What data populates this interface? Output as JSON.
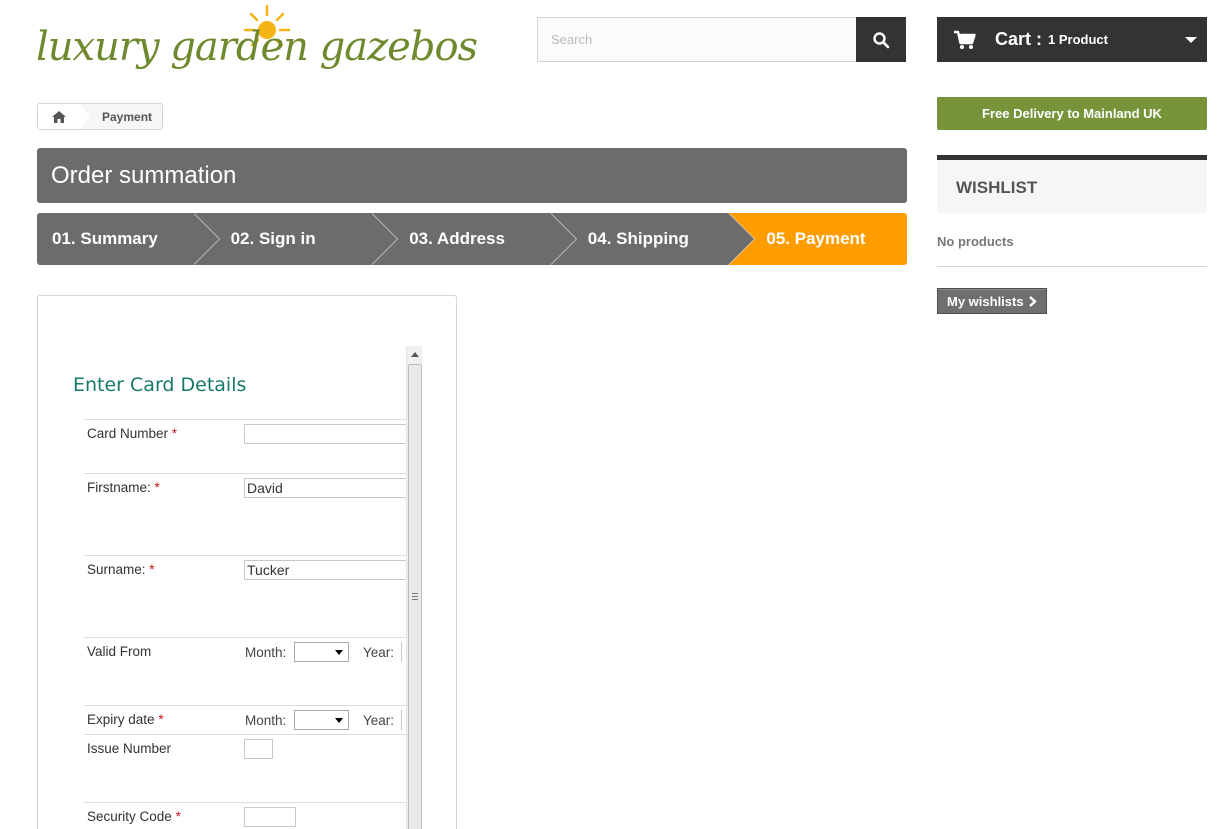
{
  "logo": {
    "text": "luxury garden gazebos"
  },
  "search": {
    "placeholder": "Search"
  },
  "cart": {
    "label": "Cart :",
    "quantity": "1 Product"
  },
  "delivery": {
    "text": "Free Delivery to Mainland UK"
  },
  "breadcrumb": {
    "current": "Payment"
  },
  "page": {
    "title": "Order summation"
  },
  "steps": [
    {
      "label": "01. Summary",
      "active": false
    },
    {
      "label": "02. Sign in",
      "active": false
    },
    {
      "label": "03. Address",
      "active": false
    },
    {
      "label": "04. Shipping",
      "active": false
    },
    {
      "label": "05. Payment",
      "active": true
    }
  ],
  "card_form": {
    "title": "Enter Card Details",
    "required_mark": "*",
    "card_number": {
      "label": "Card Number",
      "value": ""
    },
    "firstname": {
      "label": "Firstname:",
      "value": "David"
    },
    "surname": {
      "label": "Surname:",
      "value": "Tucker"
    },
    "valid_from": {
      "label": "Valid From",
      "month_label": "Month:",
      "year_label": "Year:"
    },
    "expiry": {
      "label": "Expiry date",
      "month_label": "Month:",
      "year_label": "Year:"
    },
    "issue_number": {
      "label": "Issue Number"
    },
    "security_code": {
      "label": "Security Code"
    }
  },
  "wishlist": {
    "title": "WISHLIST",
    "empty_text": "No products",
    "button_label": "My wishlists"
  },
  "colors": {
    "dark": "#333333",
    "step_gray": "#6d6b6b",
    "step_active": "#fe9c00",
    "delivery_green": "#77943a",
    "logo_green": "#6f8a2e",
    "card_title": "#177a68",
    "required_red": "#c0151b"
  }
}
